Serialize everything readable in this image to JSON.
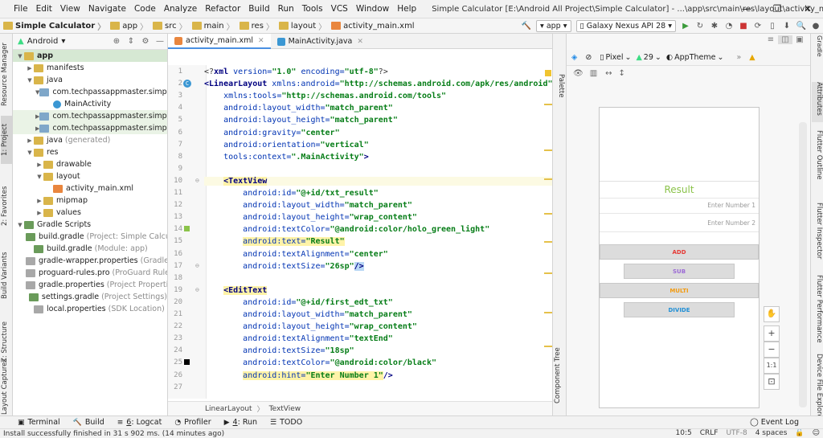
{
  "menubar": {
    "items": [
      "File",
      "Edit",
      "View",
      "Navigate",
      "Code",
      "Analyze",
      "Refactor",
      "Build",
      "Run",
      "Tools",
      "VCS",
      "Window",
      "Help"
    ],
    "title": "Simple Calculator [E:\\Android All Project\\Simple Calculator] - ...\\app\\src\\main\\res\\layout\\activity_main.xml [app]",
    "minimize": "—",
    "maximize": "❐",
    "close": "✕"
  },
  "navbar": {
    "crumbs": [
      "Simple Calculator",
      "app",
      "src",
      "main",
      "res",
      "layout",
      "activity_main.xml"
    ],
    "run_config": "app",
    "device": "Galaxy Nexus API 28"
  },
  "left_tabs": [
    "Resource Manager",
    "1: Project",
    "2: Favorites",
    "Build Variants",
    "Z: Structure",
    "Layout Captures"
  ],
  "project": {
    "view_label": "Android",
    "tree": [
      {
        "level": 0,
        "arrow": "▼",
        "icon": "folder",
        "label": "app",
        "bold": true,
        "selected": true
      },
      {
        "level": 1,
        "arrow": "▶",
        "icon": "folder",
        "label": "manifests"
      },
      {
        "level": 1,
        "arrow": "▼",
        "icon": "folder",
        "label": "java"
      },
      {
        "level": 2,
        "arrow": "▼",
        "icon": "pkg",
        "label": "com.techpassappmaster.simplecal"
      },
      {
        "level": 3,
        "arrow": "",
        "icon": "cls",
        "label": "MainActivity"
      },
      {
        "level": 2,
        "arrow": "▶",
        "icon": "pkg",
        "label": "com.techpassappmaster.simplecal",
        "hl": true
      },
      {
        "level": 2,
        "arrow": "▶",
        "icon": "pkg",
        "label": "com.techpassappmaster.simplecal",
        "hl": true
      },
      {
        "level": 1,
        "arrow": "▶",
        "icon": "folder",
        "label": "java",
        "gray": "(generated)"
      },
      {
        "level": 1,
        "arrow": "▼",
        "icon": "folder",
        "label": "res"
      },
      {
        "level": 2,
        "arrow": "▶",
        "icon": "folder",
        "label": "drawable"
      },
      {
        "level": 2,
        "arrow": "▼",
        "icon": "folder",
        "label": "layout"
      },
      {
        "level": 3,
        "arrow": "",
        "icon": "xml",
        "label": "activity_main.xml"
      },
      {
        "level": 2,
        "arrow": "▶",
        "icon": "folder",
        "label": "mipmap"
      },
      {
        "level": 2,
        "arrow": "▶",
        "icon": "folder",
        "label": "values"
      },
      {
        "level": 0,
        "arrow": "▼",
        "icon": "gradle",
        "label": "Gradle Scripts"
      },
      {
        "level": 1,
        "arrow": "",
        "icon": "gradle",
        "label": "build.gradle",
        "gray": "(Project: Simple Calculato"
      },
      {
        "level": 1,
        "arrow": "",
        "icon": "gradle",
        "label": "build.gradle",
        "gray": "(Module: app)"
      },
      {
        "level": 1,
        "arrow": "",
        "icon": "file",
        "label": "gradle-wrapper.properties",
        "gray": "(Gradle Ver"
      },
      {
        "level": 1,
        "arrow": "",
        "icon": "file",
        "label": "proguard-rules.pro",
        "gray": "(ProGuard Rules fo"
      },
      {
        "level": 1,
        "arrow": "",
        "icon": "file",
        "label": "gradle.properties",
        "gray": "(Project Properties)"
      },
      {
        "level": 1,
        "arrow": "",
        "icon": "gradle",
        "label": "settings.gradle",
        "gray": "(Project Settings)"
      },
      {
        "level": 1,
        "arrow": "",
        "icon": "file",
        "label": "local.properties",
        "gray": "(SDK Location)"
      }
    ]
  },
  "editor": {
    "tabs": [
      {
        "label": "activity_main.xml",
        "active": true,
        "color": "#e9863e"
      },
      {
        "label": "MainActivity.java",
        "active": false,
        "color": "#3b97d3"
      }
    ],
    "lines": [
      {
        "n": "1",
        "html": "<span class=\"pl\">&lt;?</span><span class=\"tag\">xml </span><span class=\"att\">version=</span><span class=\"val\">\"1.0\" </span><span class=\"att\">encoding=</span><span class=\"val\">\"utf-8\"</span><span class=\"pl\">?&gt;</span>"
      },
      {
        "n": "2",
        "html": "<span class=\"tag\">&lt;LinearLayout </span><span class=\"att\">xmlns:android=</span><span class=\"val\">\"http://schemas.android.com/apk/res/android\"</span>"
      },
      {
        "n": "3",
        "html": "    <span class=\"att\">xmlns:tools=</span><span class=\"val\">\"http://schemas.android.com/tools\"</span>"
      },
      {
        "n": "4",
        "html": "    <span class=\"att\">android:layout_width=</span><span class=\"val\">\"match_parent\"</span>"
      },
      {
        "n": "5",
        "html": "    <span class=\"att\">android:layout_height=</span><span class=\"val\">\"match_parent\"</span>"
      },
      {
        "n": "6",
        "html": "    <span class=\"att\">android:gravity=</span><span class=\"val\">\"center\"</span>"
      },
      {
        "n": "7",
        "html": "    <span class=\"att\">android:orientation=</span><span class=\"val\">\"vertical\"</span>"
      },
      {
        "n": "8",
        "html": "    <span class=\"att\">tools:context=</span><span class=\"val\">\".MainActivity\"</span><span class=\"tag\">&gt;</span>"
      },
      {
        "n": "9",
        "html": ""
      },
      {
        "n": "10",
        "html": "    <span class=\"tag yl\">&lt;TextView</span>",
        "cur": true
      },
      {
        "n": "11",
        "html": "        <span class=\"att\">android:id=</span><span class=\"val\">\"@+id/txt_result\"</span>"
      },
      {
        "n": "12",
        "html": "        <span class=\"att\">android:layout_width=</span><span class=\"val\">\"match_parent\"</span>"
      },
      {
        "n": "13",
        "html": "        <span class=\"att\">android:layout_height=</span><span class=\"val\">\"wrap_content\"</span>"
      },
      {
        "n": "14",
        "html": "        <span class=\"att\">android:textColor=</span><span class=\"val\">\"@android:color/holo_green_light\"</span>"
      },
      {
        "n": "15",
        "html": "        <span class=\"yl\"><span class=\"att\">android:text=</span><span class=\"val\">\"Result\"</span></span>"
      },
      {
        "n": "16",
        "html": "        <span class=\"att\">android:textAlignment=</span><span class=\"val\">\"center\"</span>"
      },
      {
        "n": "17",
        "html": "        <span class=\"att\">android:textSize=</span><span class=\"val\">\"26sp\"</span><span class=\"tag\" style=\"background:#b9d7f5\">/&gt;</span>"
      },
      {
        "n": "18",
        "html": ""
      },
      {
        "n": "19",
        "html": "    <span class=\"tag yl\">&lt;EditText</span>"
      },
      {
        "n": "20",
        "html": "        <span class=\"att\">android:id=</span><span class=\"val\">\"@+id/first_edt_txt\"</span>"
      },
      {
        "n": "21",
        "html": "        <span class=\"att\">android:layout_width=</span><span class=\"val\">\"match_parent\"</span>"
      },
      {
        "n": "22",
        "html": "        <span class=\"att\">android:layout_height=</span><span class=\"val\">\"wrap_content\"</span>"
      },
      {
        "n": "23",
        "html": "        <span class=\"att\">android:textAlignment=</span><span class=\"val\">\"textEnd\"</span>"
      },
      {
        "n": "24",
        "html": "        <span class=\"att\">android:textSize=</span><span class=\"val\">\"18sp\"</span>"
      },
      {
        "n": "25",
        "html": "        <span class=\"att\">android:textColor=</span><span class=\"val\">\"@android:color/black\"</span>"
      },
      {
        "n": "26",
        "html": "        <span class=\"yl\"><span class=\"att\">android:hint=</span><span class=\"val\">\"Enter Number 1\"</span></span><span class=\"tag\">/&gt;</span>"
      },
      {
        "n": "27",
        "html": ""
      }
    ],
    "breadcrumb": [
      "LinearLayout",
      "TextView"
    ]
  },
  "palette_tabs": [
    "Palette",
    "Component Tree"
  ],
  "design": {
    "device": "Pixel",
    "api": "29",
    "theme": "AppTheme",
    "result_text": "Result",
    "result_color": "#8bc34a",
    "hint1": "Enter Number 1",
    "hint2": "Enter Number 2",
    "buttons": [
      {
        "label": "ADD",
        "color": "#e53935"
      },
      {
        "label": "SUB",
        "color": "#9c6ad6"
      },
      {
        "label": "MULTI",
        "color": "#f39c12"
      },
      {
        "label": "DIVIDE",
        "color": "#1f8fd6"
      }
    ],
    "zoom": [
      "+",
      "−",
      "1:1",
      "⊡"
    ]
  },
  "right_tabs": [
    "Gradle",
    "Flutter Outline",
    "Flutter Inspector",
    "Flutter Performance",
    "Device File Explorer"
  ],
  "attributes_tab": "Attributes",
  "bottom_tools": [
    {
      "label": "Terminal",
      "u": ""
    },
    {
      "label": "Build",
      "u": ""
    },
    {
      "label": ": Logcat",
      "u": "6"
    },
    {
      "label": "Profiler",
      "u": ""
    },
    {
      "label": ": Run",
      "u": "4"
    },
    {
      "label": "TODO",
      "u": ""
    }
  ],
  "event_log": "Event Log",
  "status": {
    "message": "Install successfully finished in 31 s 902 ms. (14 minutes ago)",
    "pos": "10:5",
    "eol": "CRLF",
    "enc": "UTF-8",
    "indent": "4 spaces"
  }
}
